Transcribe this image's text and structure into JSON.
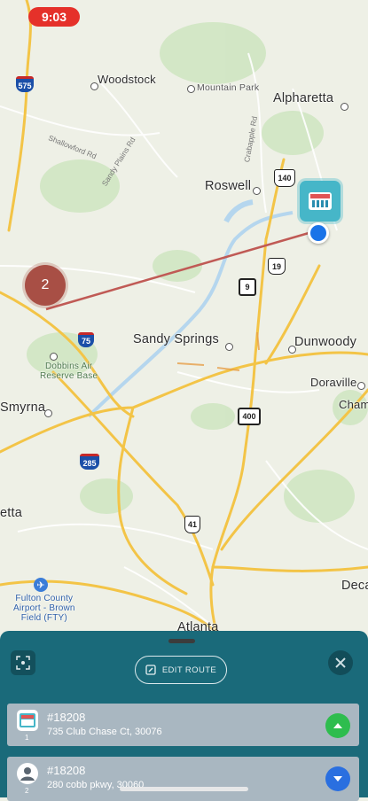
{
  "status_bar": {
    "time": "9:03"
  },
  "map": {
    "places": {
      "woodstock": "Woodstock",
      "mountain_park": "Mountain Park",
      "alpharetta": "Alpharetta",
      "roswell": "Roswell",
      "sandy_springs": "Sandy Springs",
      "dunwoody": "Dunwoody",
      "doraville": "Doraville",
      "chamblee": "Cham",
      "smyrna": "Smyrna",
      "marietta_partial": "etta",
      "decatur_partial": "Deca",
      "atlanta_partial": "Atlanta",
      "dobbins": "Dobbins Air\nReserve Base",
      "airport": "Fulton County\nAirport - Brown\nField (FTY)"
    },
    "roads": {
      "shallowford": "Shallowford Rd",
      "sandy_plains": "Sandy Plains Rd",
      "crabapple": "Crabapple Rd"
    },
    "shields": {
      "i575": "575",
      "us140": "140",
      "ga19": "19",
      "ga9": "9",
      "i75": "75",
      "i400": "400",
      "i285": "285",
      "us41": "41"
    },
    "cluster_count": "2"
  },
  "panel": {
    "edit_route_label": "EDIT ROUTE",
    "stops": [
      {
        "number": "1",
        "id": "#18208",
        "address": "735 Club Chase Ct,  30076",
        "action": "move-up"
      },
      {
        "number": "2",
        "id": "#18208",
        "address": "280 cobb pkwy,  30060",
        "action": "move-down"
      }
    ]
  },
  "colors": {
    "panel_bg": "#1a6a7a",
    "stop_bg": "#a9b7c1",
    "route_line": "#c05a55",
    "cluster": "#a84f45",
    "store_pin": "#46b6c8",
    "location_dot": "#1a73e8",
    "up_button": "#2ebd4e",
    "down_button": "#2a6fe0",
    "time_pill": "#e5312a"
  }
}
